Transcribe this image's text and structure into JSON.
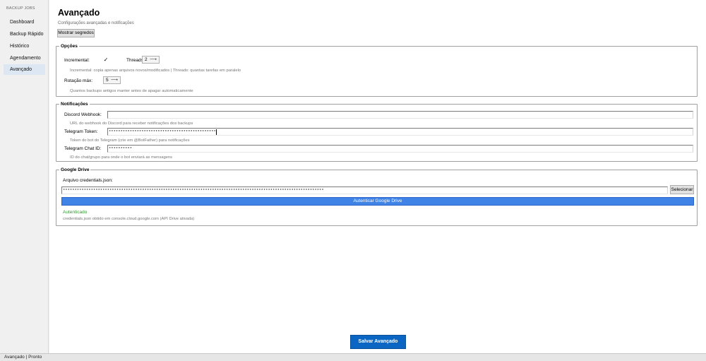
{
  "sidebar": {
    "brand": "BACKUP JOBS",
    "items": [
      {
        "label": "Dashboard"
      },
      {
        "label": "Backup Rápido"
      },
      {
        "label": "Histórico"
      },
      {
        "label": "Agendamento"
      },
      {
        "label": "Avançado",
        "active": true
      }
    ]
  },
  "page": {
    "title": "Avançado",
    "subtitle": "Configurações avançadas e notificações",
    "show_secrets_label": "Mostrar segredos"
  },
  "options": {
    "title": "Opções",
    "incremental_label": "Incremental:",
    "incremental_checked": true,
    "incremental_mark": "✓",
    "threads_label": "Threads:",
    "threads_value": "2",
    "hint1": "Incremental: copia apenas arquivos novos/modificados | Threads: quantas tarefas em paralelo",
    "rotation_label": "Rotação máx:",
    "rotation_value": "5",
    "hint2": "Quantos backups antigos manter antes de apagar automaticamente"
  },
  "notifications": {
    "title": "Notificações",
    "discord_label": "Discord Webhook:",
    "discord_value": "",
    "discord_hint": "URL do webhook do Discord para receber notificações dos backups",
    "telegram_token_label": "Telegram Token:",
    "telegram_token_value": "**********************************************",
    "telegram_token_hint": "Token do bot do Telegram (crie em @BotFather) para notificações",
    "telegram_chat_label": "Telegram Chat ID:",
    "telegram_chat_value": "**********",
    "telegram_chat_hint": "ID do chat/grupo para onde o bot enviará as mensagens"
  },
  "gdrive": {
    "title": "Google Drive",
    "file_label": "Arquivo credentials.json:",
    "file_value": "****************************************************************************************************************",
    "select_label": "Selecionar",
    "auth_label": "Autenticar Google Drive",
    "status": "Autenticado",
    "status_color": "#2a9c2a",
    "hint": "credentials.json obtido em console.cloud.google.com (API Drive ativada)"
  },
  "footer": {
    "save_label": "Salvar Avançado"
  },
  "statusbar": {
    "text": "Avançado | Pronto"
  },
  "colors": {
    "accent": "#3f83e6",
    "save_button": "#0a66c2",
    "active_nav": "#dde7f3"
  }
}
